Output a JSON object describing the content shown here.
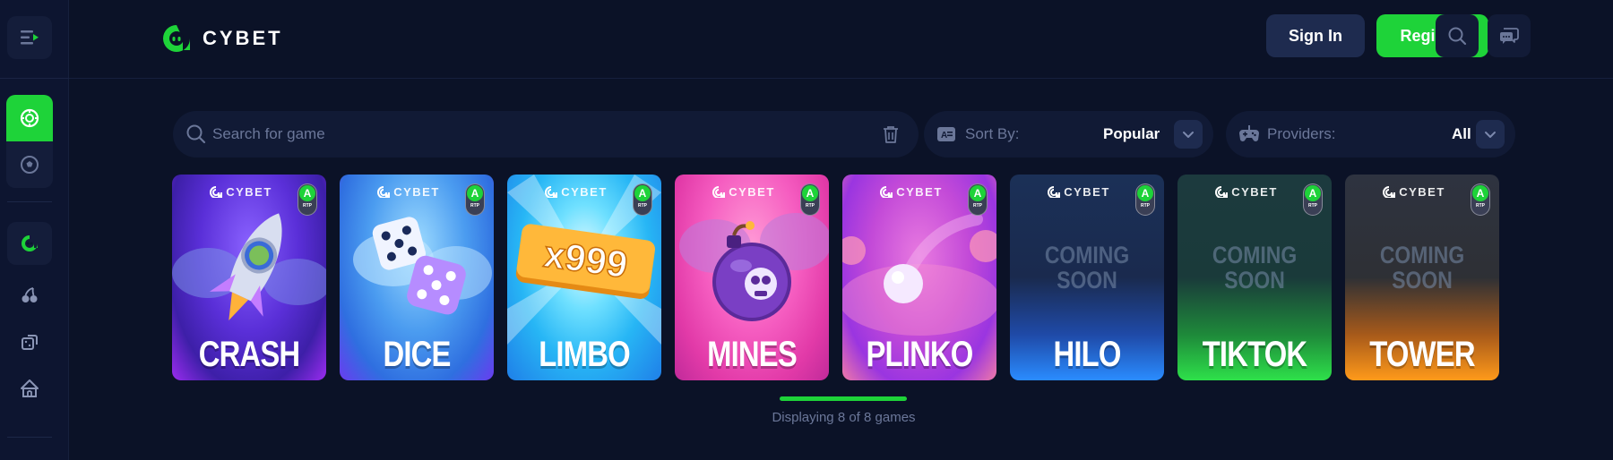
{
  "brand": {
    "name": "CYBET"
  },
  "header": {
    "signin_label": "Sign In",
    "register_label": "Register"
  },
  "filters": {
    "search_placeholder": "Search for game",
    "sort_label": "Sort By:",
    "sort_value": "Popular",
    "providers_label": "Providers:",
    "providers_value": "All"
  },
  "games": [
    {
      "name": "CRASH",
      "brand": "CYBET",
      "rtp": "A",
      "rtp_text": "RTP",
      "coming_soon": ""
    },
    {
      "name": "DICE",
      "brand": "CYBET",
      "rtp": "A",
      "rtp_text": "RTP",
      "coming_soon": ""
    },
    {
      "name": "LIMBO",
      "brand": "CYBET",
      "rtp": "A",
      "rtp_text": "RTP",
      "coming_soon": "",
      "badge": "x999"
    },
    {
      "name": "MINES",
      "brand": "CYBET",
      "rtp": "A",
      "rtp_text": "RTP",
      "coming_soon": ""
    },
    {
      "name": "PLINKO",
      "brand": "CYBET",
      "rtp": "A",
      "rtp_text": "RTP",
      "coming_soon": ""
    },
    {
      "name": "HILO",
      "brand": "CYBET",
      "rtp": "A",
      "rtp_text": "RTP",
      "coming_soon": "COMING SOON"
    },
    {
      "name": "TIKTOK",
      "brand": "CYBET",
      "rtp": "A",
      "rtp_text": "RTP",
      "coming_soon": "COMING SOON"
    },
    {
      "name": "TOWER",
      "brand": "CYBET",
      "rtp": "A",
      "rtp_text": "RTP",
      "coming_soon": "COMING SOON"
    }
  ],
  "pagination": {
    "displaying_text": "Displaying 8 of 8 games",
    "progress": 1.0
  },
  "colors": {
    "accent": "#1ed339",
    "background": "#0b1227",
    "panel": "#111a35"
  },
  "icons": {
    "sidebar_menu": "menu-collapse-icon",
    "sidebar_tab_casino": "casino-chip-icon",
    "sidebar_tab_sports": "soccer-ball-icon",
    "sidebar_items": [
      "cybet-originals-icon",
      "cherries-slots-icon",
      "dice-table-icon",
      "circus-tent-icon"
    ],
    "header_search": "search-icon",
    "header_chat": "chat-icon",
    "search_trash": "trash-icon",
    "sort_icon": "sort-az-icon",
    "providers_icon": "gamepad-icon",
    "dropdown": "chevron-down-icon"
  }
}
